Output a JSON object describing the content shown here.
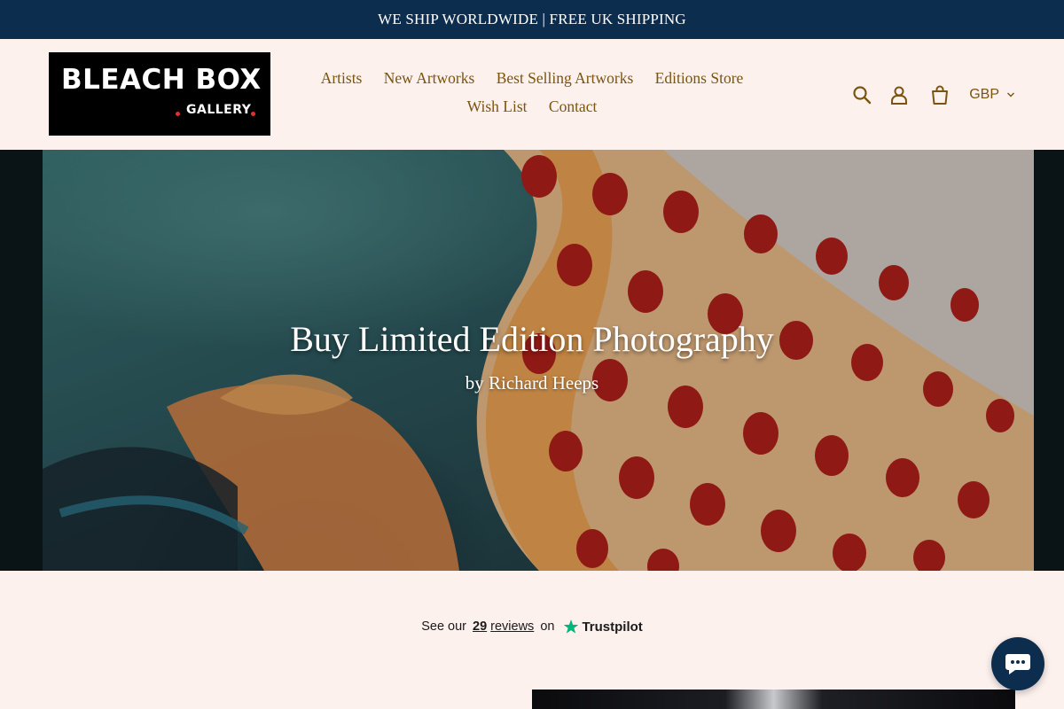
{
  "announcement": {
    "text": "WE SHIP WORLDWIDE | FREE UK SHIPPING"
  },
  "header": {
    "logo": {
      "brand": "BLEACH BOX",
      "sub": "GALLERY"
    },
    "nav": [
      {
        "label": "Artists"
      },
      {
        "label": "New Artworks"
      },
      {
        "label": "Best Selling Artworks"
      },
      {
        "label": "Editions Store"
      },
      {
        "label": "Wish List"
      },
      {
        "label": "Contact"
      }
    ],
    "tools": {
      "search_icon": "search-icon",
      "account_icon": "account-icon",
      "cart_icon": "cart-icon",
      "currency": "GBP"
    }
  },
  "hero": {
    "title": "Buy Limited Edition Photography",
    "subtitle": "by Richard Heeps"
  },
  "trustpilot": {
    "prefix": "See our",
    "count": "29",
    "reviews_label": "reviews",
    "on_label": "on",
    "brand": "Trustpilot"
  },
  "colors": {
    "announcement_bg": "#0d2d4e",
    "page_bg": "#fdf1ee",
    "link_color": "#7a5410",
    "trustpilot_star": "#00b67a"
  }
}
